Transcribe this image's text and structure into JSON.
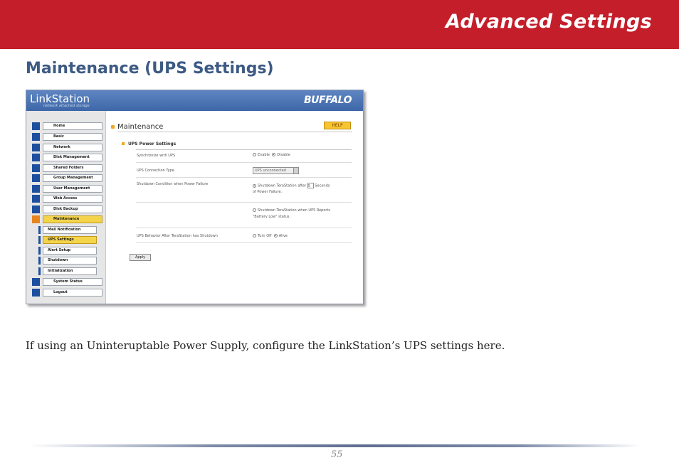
{
  "header": {
    "section_title": "Advanced Settings",
    "accent_color": "#c41e2b"
  },
  "page_heading": "Maintenance (UPS Settings)",
  "screenshot": {
    "brand": "LinkStation",
    "brand_tagline": "network attached storage",
    "vendor_logo": "BUFFALO",
    "sidebar": {
      "items": [
        {
          "label": "Home",
          "icon": "home-icon"
        },
        {
          "label": "Basic",
          "icon": "basic-icon"
        },
        {
          "label": "Network",
          "icon": "network-icon"
        },
        {
          "label": "Disk Management",
          "icon": "disk-icon"
        },
        {
          "label": "Shared Folders",
          "icon": "folder-icon"
        },
        {
          "label": "Group Management",
          "icon": "group-icon"
        },
        {
          "label": "User Management",
          "icon": "user-icon"
        },
        {
          "label": "Web Access",
          "icon": "globe-icon"
        },
        {
          "label": "Disk Backup",
          "icon": "backup-icon"
        },
        {
          "label": "Maintenance",
          "icon": "wrench-icon"
        }
      ],
      "subitems": [
        {
          "label": "Mail Notification"
        },
        {
          "label": "UPS Settings"
        },
        {
          "label": "Alert Setup"
        },
        {
          "label": "Shutdown"
        },
        {
          "label": "Initialization"
        }
      ],
      "bottom_items": [
        {
          "label": "System Status",
          "icon": "status-icon"
        },
        {
          "label": "Logout",
          "icon": "logout-icon"
        }
      ]
    },
    "main": {
      "title": "Maintenance",
      "help_label": "HELP",
      "section_title": "UPS Power Settings",
      "rows": [
        {
          "label": "Synchronize with UPS",
          "option_a": "Enable",
          "option_b": "Disable",
          "selected": "Disable"
        },
        {
          "label": "UPS Connection Type",
          "select_value": "UPS unconnected"
        },
        {
          "label": "Shutdown Condition when Power Failure",
          "option_a_pre": "Shutdown TeraStation after",
          "option_a_value": "5",
          "option_a_post": "Seconds",
          "option_a_tail": "of Power Failure.",
          "option_b_line1": "Shutdown TeraStation when UPS Reports",
          "option_b_line2": "\"Battery Low\" status."
        },
        {
          "label": "UPS Behavior After TeraStation has Shutdown",
          "option_a": "Turn Off",
          "option_b": "Alive",
          "selected": "Alive"
        }
      ],
      "apply_label": "Apply"
    }
  },
  "body_text": "If using an Uninteruptable Power Supply, configure the LinkStation’s UPS settings here.",
  "page_number": "55"
}
